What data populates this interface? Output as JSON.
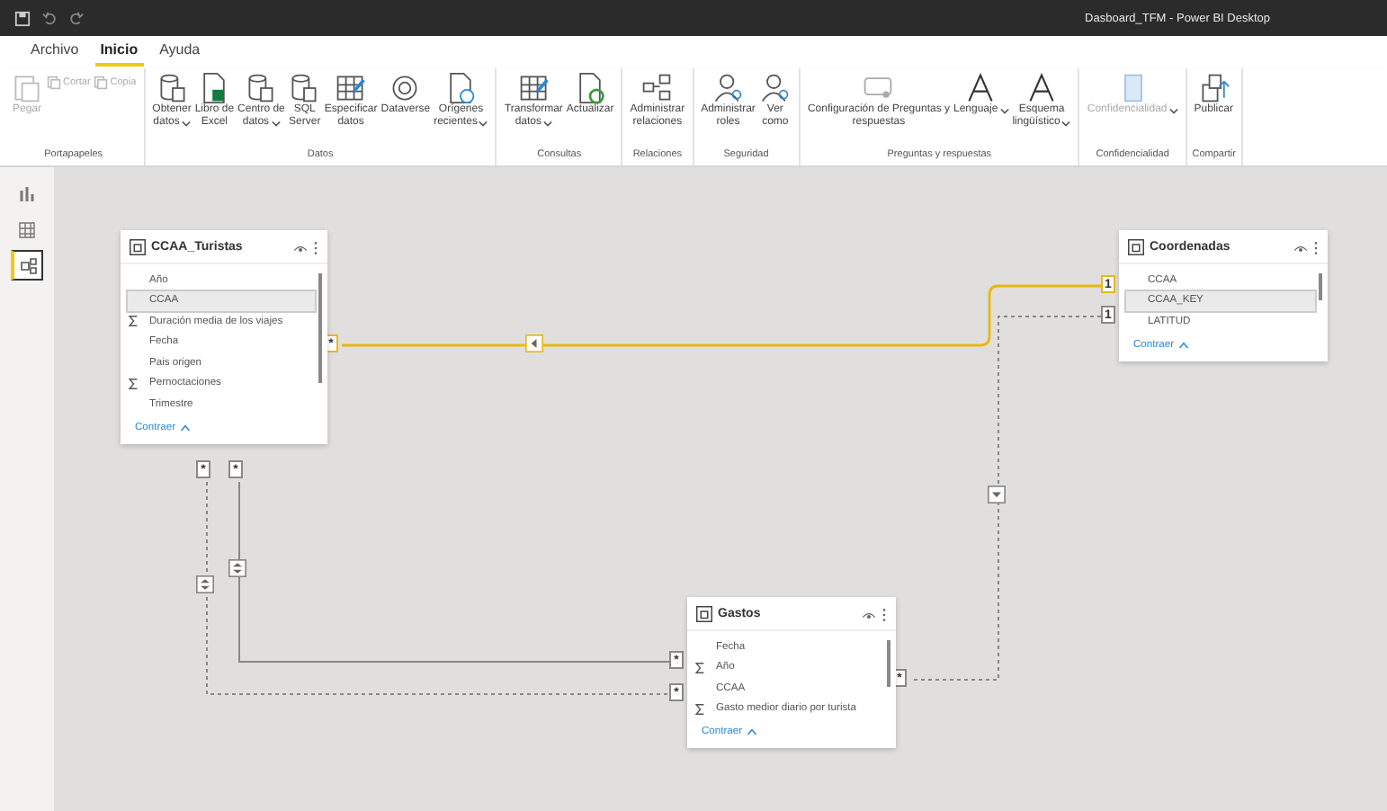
{
  "window": {
    "title": "Dasboard_TFM - Power BI Desktop"
  },
  "menu_tabs": [
    {
      "label": "Archivo",
      "selected": false
    },
    {
      "label": "Inicio",
      "selected": true
    },
    {
      "label": "Ayuda",
      "selected": false
    }
  ],
  "ribbon_groups": [
    {
      "label": "Portapapeles",
      "buttons": [
        {
          "lines": [
            "Pegar"
          ],
          "disabled": true,
          "dropdown": false,
          "kind": "large"
        },
        {
          "lines": [
            "Cortar"
          ],
          "disabled": true,
          "dropdown": false,
          "kind": "small"
        },
        {
          "lines": [
            "Copia"
          ],
          "disabled": true,
          "dropdown": false,
          "kind": "small"
        }
      ]
    },
    {
      "label": "Datos",
      "buttons": [
        {
          "lines": [
            "Obtener",
            "datos"
          ],
          "disabled": false,
          "dropdown": true,
          "kind": "large"
        },
        {
          "lines": [
            "Libro de",
            "Excel"
          ],
          "disabled": false,
          "dropdown": false,
          "kind": "large"
        },
        {
          "lines": [
            "Centro de",
            "datos"
          ],
          "disabled": false,
          "dropdown": true,
          "kind": "large"
        },
        {
          "lines": [
            "SQL",
            "Server"
          ],
          "disabled": false,
          "dropdown": false,
          "kind": "large"
        },
        {
          "lines": [
            "Especificar",
            "datos"
          ],
          "disabled": false,
          "dropdown": false,
          "kind": "large"
        },
        {
          "lines": [
            "Dataverse"
          ],
          "disabled": false,
          "dropdown": false,
          "kind": "large"
        },
        {
          "lines": [
            "Orígenes",
            "recientes"
          ],
          "disabled": false,
          "dropdown": true,
          "kind": "large"
        }
      ]
    },
    {
      "label": "Consultas",
      "buttons": [
        {
          "lines": [
            "Transformar",
            "datos"
          ],
          "disabled": false,
          "dropdown": true,
          "kind": "large"
        },
        {
          "lines": [
            "Actualizar"
          ],
          "disabled": false,
          "dropdown": false,
          "kind": "large"
        }
      ]
    },
    {
      "label": "Relaciones",
      "buttons": [
        {
          "lines": [
            "Administrar",
            "relaciones"
          ],
          "disabled": false,
          "dropdown": false,
          "kind": "large"
        }
      ]
    },
    {
      "label": "Seguridad",
      "buttons": [
        {
          "lines": [
            "Administrar",
            "roles"
          ],
          "disabled": false,
          "dropdown": false,
          "kind": "large"
        },
        {
          "lines": [
            "Ver",
            "como"
          ],
          "disabled": false,
          "dropdown": false,
          "kind": "large"
        }
      ]
    },
    {
      "label": "Preguntas y respuestas",
      "buttons": [
        {
          "lines": [
            "Configuración de Preguntas y",
            "respuestas"
          ],
          "disabled": false,
          "dropdown": false,
          "kind": "large"
        },
        {
          "lines": [
            "Lenguaje"
          ],
          "disabled": false,
          "dropdown": true,
          "kind": "large"
        },
        {
          "lines": [
            "Esquema",
            "lingüístico"
          ],
          "disabled": false,
          "dropdown": true,
          "kind": "large"
        }
      ]
    },
    {
      "label": "Confidencialidad",
      "buttons": [
        {
          "lines": [
            "Confidencialidad"
          ],
          "disabled": true,
          "dropdown": true,
          "kind": "large"
        }
      ]
    },
    {
      "label": "Compartir",
      "buttons": [
        {
          "lines": [
            "Publicar"
          ],
          "disabled": false,
          "dropdown": false,
          "kind": "large"
        }
      ]
    }
  ],
  "view_rail": [
    {
      "selected": false
    },
    {
      "selected": false
    },
    {
      "selected": true
    }
  ],
  "tables": [
    {
      "title": "CCAA_Turistas",
      "fields": [
        {
          "name": "Año",
          "measure": false,
          "selected": false
        },
        {
          "name": "CCAA",
          "measure": false,
          "selected": true
        },
        {
          "name": "Duración media de los viajes",
          "measure": true,
          "selected": false
        },
        {
          "name": "Fecha",
          "measure": false,
          "selected": false
        },
        {
          "name": "Pais origen",
          "measure": false,
          "selected": false
        },
        {
          "name": "Pernoctaciones",
          "measure": true,
          "selected": false
        },
        {
          "name": "Trimestre",
          "measure": false,
          "selected": false
        }
      ],
      "collapse": "Contraer"
    },
    {
      "title": "Coordenadas",
      "fields": [
        {
          "name": "CCAA",
          "measure": false,
          "selected": false
        },
        {
          "name": "CCAA_KEY",
          "measure": false,
          "selected": true
        },
        {
          "name": "LATITUD",
          "measure": false,
          "selected": false
        }
      ],
      "collapse": "Contraer"
    },
    {
      "title": "Gastos",
      "fields": [
        {
          "name": "Fecha",
          "measure": false,
          "selected": false
        },
        {
          "name": "Año",
          "measure": true,
          "selected": false
        },
        {
          "name": "CCAA",
          "measure": false,
          "selected": false
        },
        {
          "name": "Gasto medior diario por turista",
          "measure": true,
          "selected": false
        }
      ],
      "collapse": "Contraer"
    }
  ],
  "relationships": [
    {
      "end_a": "*",
      "end_b": "1",
      "active": true,
      "highlighted": true,
      "both_directions": false
    },
    {
      "end_a": "*",
      "end_b": "1",
      "active": false,
      "highlighted": false,
      "both_directions": false
    },
    {
      "end_a": "*",
      "end_b": "*",
      "active": true,
      "highlighted": false,
      "both_directions": true
    },
    {
      "end_a": "*",
      "end_b": "*",
      "active": false,
      "highlighted": false,
      "both_directions": true
    }
  ]
}
